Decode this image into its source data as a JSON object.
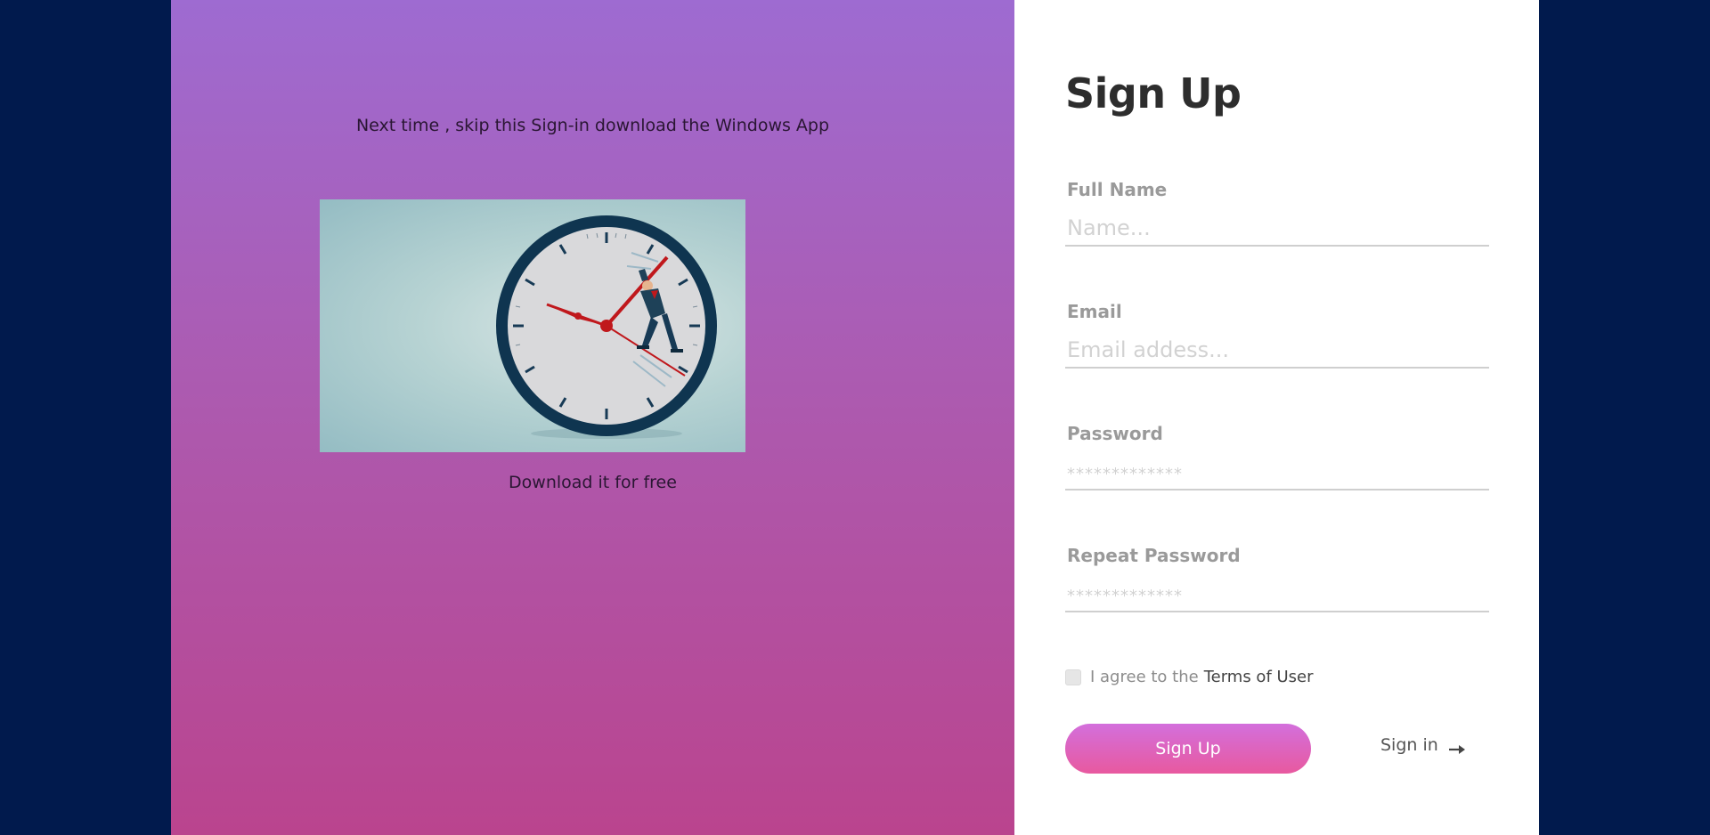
{
  "promo": {
    "headline": "Next time , skip this Sign-in download the Windows App",
    "image_icon": "clock-climber-illustration",
    "caption": "Download it for free"
  },
  "form": {
    "title": "Sign Up",
    "fields": {
      "full_name": {
        "label": "Full Name",
        "placeholder": "Name...",
        "value": ""
      },
      "email": {
        "label": "Email",
        "placeholder": "Email addess...",
        "value": ""
      },
      "password": {
        "label": "Password",
        "placeholder": "*************",
        "value": ""
      },
      "repeat_password": {
        "label": "Repeat Password",
        "placeholder": "*************",
        "value": ""
      }
    },
    "terms": {
      "text": "I agree to the",
      "link": "Terms of User",
      "checked": false
    },
    "submit_label": "Sign Up",
    "signin_label": "Sign in",
    "signin_icon": "arrow-right-icon"
  },
  "colors": {
    "page_background": "#011a4d",
    "promo_gradient_top": "#9e6bd1",
    "promo_gradient_bottom": "#ba448e",
    "button_gradient_top": "#d36fdc",
    "button_gradient_bottom": "#e8599f"
  }
}
